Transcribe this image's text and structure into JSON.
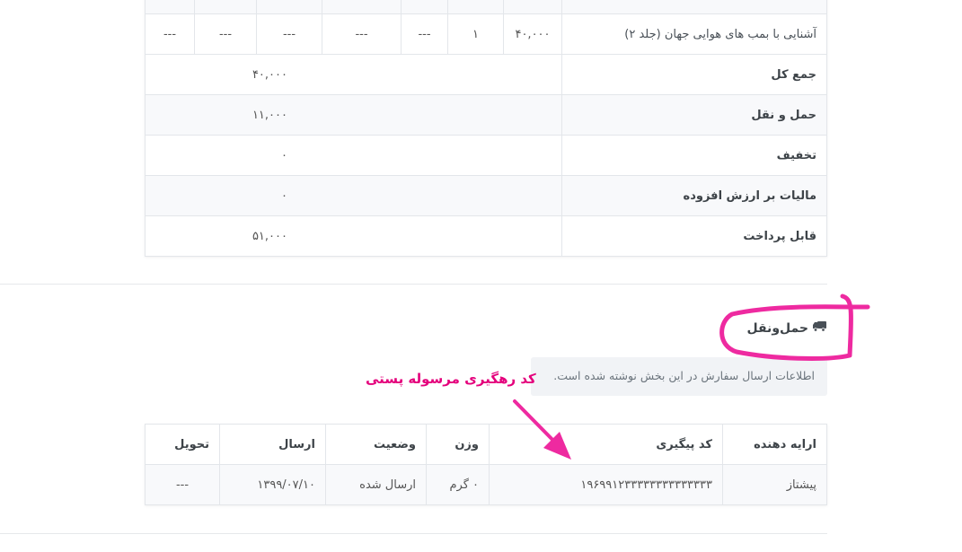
{
  "order": {
    "item": {
      "product": "آشنایی با بمب های هوایی جهان (جلد ۲)",
      "price": "۴۰,۰۰۰",
      "quantity": "۱",
      "c3": "---",
      "c4": "---",
      "c5": "---",
      "c6": "---",
      "c7": "---"
    },
    "summary": [
      {
        "label": "جمع کل",
        "value": "۴۰,۰۰۰"
      },
      {
        "label": "حمل و نقل",
        "value": "۱۱,۰۰۰"
      },
      {
        "label": "تخفیف",
        "value": "۰"
      },
      {
        "label": "مالیات بر ارزش افزوده",
        "value": "۰"
      },
      {
        "label": "قابل پرداخت",
        "value": "۵۱,۰۰۰"
      }
    ]
  },
  "shipping": {
    "title": "حمل‌ونقل",
    "icon": "truck-icon",
    "note": "اطلاعات ارسال سفارش در این بخش نوشته شده است.",
    "headers": {
      "provider": "ارایه دهنده",
      "tracking": "کد پیگیری",
      "weight": "وزن",
      "status": "وضعیت",
      "sent": "ارسال",
      "delivered": "تحویل"
    },
    "row": {
      "provider": "پیشتاز",
      "tracking": "۱۹۶۹۹۱۲۳۳۳۳۳۳۳۳۳۳۳۳۳۳",
      "weight": "۰ گرم",
      "status": "ارسال شده",
      "sent": "۱۳۹۹/۰۷/۱۰",
      "delivered": "---"
    }
  },
  "annotation": {
    "text": "کد رهگیری مرسوله پستی",
    "color": "#e4007c"
  }
}
